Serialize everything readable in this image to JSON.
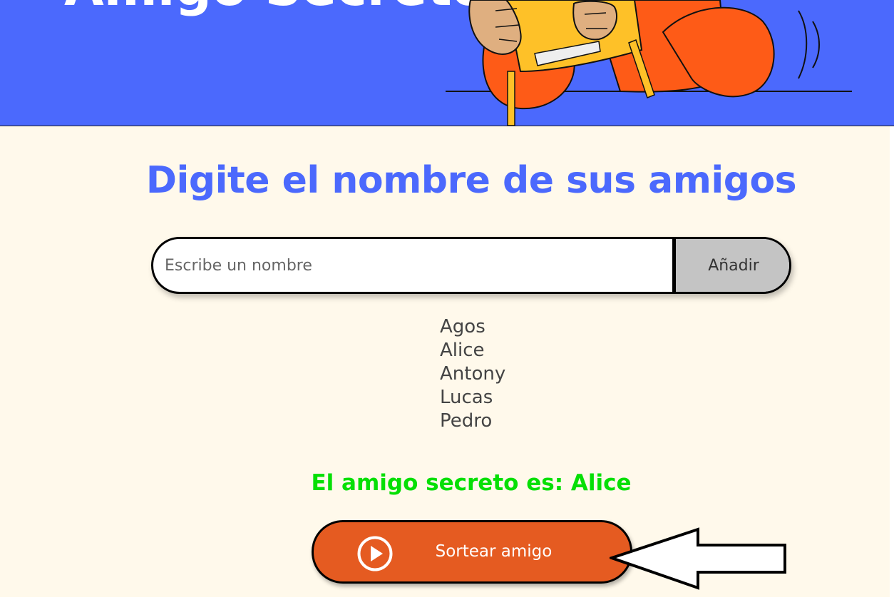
{
  "header": {
    "title": "Amigo Secreto",
    "colors": {
      "background": "#4b69fd",
      "shirt": "#fe5b17",
      "gift": "#fec128",
      "skin": "#dfaf80"
    }
  },
  "main": {
    "title": "Digite el nombre de sus amigos",
    "input": {
      "value": "",
      "placeholder": "Escribe un nombre"
    },
    "add_button_label": "Añadir",
    "friends": [
      "Agos",
      "Alice",
      "Antony",
      "Lucas",
      "Pedro"
    ],
    "result_text": "El amigo secreto es: Alice",
    "draw_button_label": "Sortear amigo",
    "draw_button_icon": "play-circle-icon",
    "colors": {
      "title": "#4b69fd",
      "result": "#05df05",
      "draw_button": "#e55b21",
      "background": "#fff9eb"
    }
  },
  "annotation": {
    "icon": "arrow-left-icon"
  }
}
